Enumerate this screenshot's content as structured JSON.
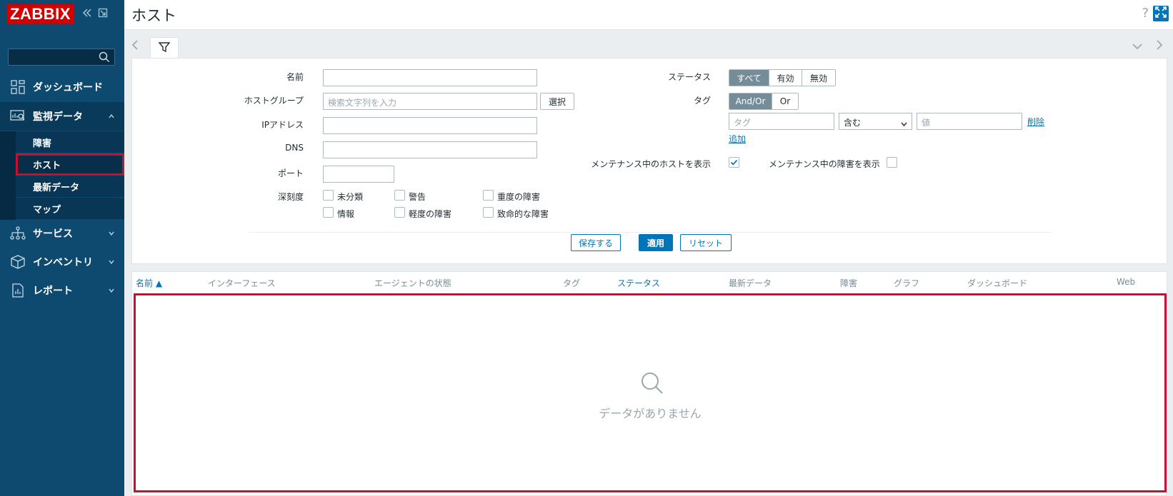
{
  "app": {
    "logo": "ZABBIX",
    "colors": {
      "sidebar": "#0e4a6f",
      "accent": "#0275b8",
      "highlight": "#c8102e"
    }
  },
  "sidebar": {
    "collapse_icon": "double-chevron-left-icon",
    "kiosk_icon": "expand-icon",
    "nav": [
      {
        "label": "ダッシュボード",
        "icon": "dashboard-grid-icon"
      },
      {
        "label": "監視データ",
        "icon": "monitoring-icon"
      },
      {
        "label": "サービス",
        "icon": "services-tree-icon"
      },
      {
        "label": "インベントリ",
        "icon": "inventory-box-icon"
      },
      {
        "label": "レポート",
        "icon": "report-icon"
      }
    ],
    "submenu": [
      {
        "label": "障害"
      },
      {
        "label": "ホスト"
      },
      {
        "label": "最新データ"
      },
      {
        "label": "マップ"
      }
    ]
  },
  "header": {
    "title": "ホスト",
    "help": "?"
  },
  "filter": {
    "name_label": "名前",
    "hostgroup_label": "ホストグループ",
    "hostgroup_placeholder": "検索文字列を入力",
    "select_button": "選択",
    "ip_label": "IPアドレス",
    "dns_label": "DNS",
    "port_label": "ポート",
    "severity_label": "深刻度",
    "severities": [
      "未分類",
      "警告",
      "重度の障害",
      "情報",
      "軽度の障害",
      "致命的な障害"
    ],
    "status_label": "ステータス",
    "status_options": [
      "すべて",
      "有効",
      "無効"
    ],
    "tag_label": "タグ",
    "tag_ops": [
      "And/Or",
      "Or"
    ],
    "tag_placeholder": "タグ",
    "tag_operator": "含む",
    "value_placeholder": "値",
    "remove_link": "削除",
    "add_link": "追加",
    "maint_hosts_label": "メンテナンス中のホストを表示",
    "maint_hosts_checked": true,
    "maint_problems_label": "メンテナンス中の障害を表示",
    "maint_problems_checked": false,
    "save_button": "保存する",
    "apply_button": "適用",
    "reset_button": "リセット"
  },
  "table": {
    "columns": [
      "名前 ▲",
      "インターフェース",
      "エージェントの状態",
      "タグ",
      "ステータス",
      "最新データ",
      "障害",
      "グラフ",
      "ダッシュボード",
      "Web"
    ],
    "empty_text": "データがありません"
  }
}
